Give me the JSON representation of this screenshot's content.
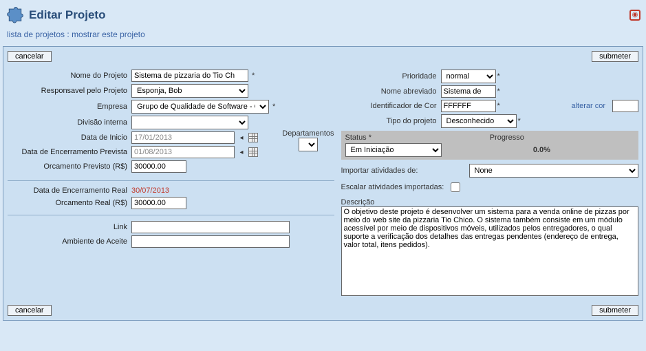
{
  "header": {
    "title": "Editar Projeto"
  },
  "breadcrumb": {
    "list_link": "lista de projetos",
    "sep": " : ",
    "show_link": "mostrar este projeto"
  },
  "buttons": {
    "cancel": "cancelar",
    "submit": "submeter"
  },
  "left": {
    "project_name_label": "Nome do Projeto",
    "project_name_value": "Sistema de pizzaria do Tio Ch",
    "owner_label": "Responsavel pelo Projeto",
    "owner_value": "Esponja, Bob",
    "company_label": "Empresa",
    "company_value": "Grupo de Qualidade de Software - GQS",
    "division_label": "Divisão interna",
    "division_value": "",
    "start_date_label": "Data de Inicio",
    "start_date_value": "17/01/2013",
    "end_date_label": "Data de Encerramento Prevista",
    "end_date_value": "01/08/2013",
    "budget_label": "Orcamento Previsto (R$)",
    "budget_value": "30000.00",
    "real_end_label": "Data de Encerramento Real",
    "real_end_value": "30/07/2013",
    "real_budget_label": "Orcamento Real (R$)",
    "real_budget_value": "30000.00",
    "link_label": "Link",
    "link_value": "",
    "env_label": "Ambiente de Aceite",
    "env_value": "",
    "departments_label": "Departamentos"
  },
  "right": {
    "priority_label": "Prioridade",
    "priority_value": "normal",
    "shortname_label": "Nome abreviado",
    "shortname_value": "Sistema de",
    "color_id_label": "Identificador de Cor",
    "color_id_value": "FFFFFF",
    "change_color": "alterar cor",
    "type_label": "Tipo do projeto",
    "type_value": "Desconhecido",
    "status_label": "Status *",
    "status_value": "Em Iniciação",
    "progress_label": "Progresso",
    "progress_value": "0.0%",
    "import_label": "Importar atividades de:",
    "import_value": "None",
    "escalate_label": "Escalar atividades importadas:",
    "description_label": "Descrição",
    "description_value": "O objetivo deste projeto é desenvolver um sistema para a venda online de pizzas por meio do web site da pizzaria Tio Chico. O sistema também consiste em um módulo acessível por meio de dispositivos móveis, utilizados pelos entregadores, o qual suporte a verificação dos detalhes das entregas pendentes (endereço de entrega, valor total, itens pedidos)."
  }
}
